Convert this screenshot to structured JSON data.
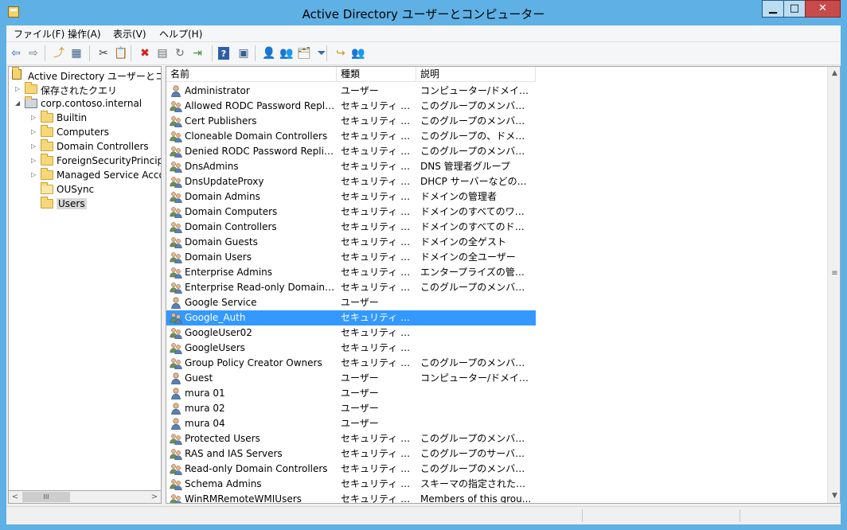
{
  "window": {
    "title": "Active Directory ユーザーとコンピューター",
    "minimize_label": "▁",
    "maximize_label": "□",
    "close_label": "✕"
  },
  "menu": [
    {
      "label": "ファイル(F)"
    },
    {
      "label": "操作(A)"
    },
    {
      "label": "表示(V)"
    },
    {
      "label": "ヘルプ(H)"
    }
  ],
  "toolbar": [
    {
      "icon": "back-arrow-icon",
      "glyph": "⇦",
      "color": "#2f6db5"
    },
    {
      "icon": "forward-arrow-icon",
      "glyph": "⇨",
      "color": "#7a7a7a"
    },
    {
      "icon": "up-folder-icon",
      "glyph": "⤴",
      "color": "#c89a2a"
    },
    {
      "icon": "show-hide-console-tree-icon",
      "glyph": "▦",
      "color": "#3a5f8a"
    },
    {
      "icon": "cut-icon",
      "glyph": "✂",
      "color": "#3a3a3a"
    },
    {
      "icon": "paste-icon",
      "glyph": "📋",
      "color": "#3a3a3a"
    },
    {
      "icon": "delete-icon",
      "glyph": "✖",
      "color": "#d42020"
    },
    {
      "icon": "properties-icon",
      "glyph": "▤",
      "color": "#6a6a6a"
    },
    {
      "icon": "refresh-icon",
      "glyph": "↻",
      "color": "#6a6a6a"
    },
    {
      "icon": "export-list-icon",
      "glyph": "⇥",
      "color": "#3f8a3f"
    },
    {
      "icon": "help-icon",
      "glyph": "?",
      "color": "#ffffff"
    },
    {
      "icon": "show-action-pane-icon",
      "glyph": "▣",
      "color": "#3a5f8a"
    },
    {
      "icon": "new-user-icon",
      "glyph": "👤",
      "color": "#5a6e8a"
    },
    {
      "icon": "new-group-icon",
      "glyph": "👥",
      "color": "#5a6e8a"
    },
    {
      "icon": "new-ou-icon",
      "glyph": "🗂",
      "color": "#7a6a3a"
    },
    {
      "icon": "filter-icon",
      "glyph": "⏷",
      "color": "#3a6a9a"
    },
    {
      "icon": "add-to-group-icon",
      "glyph": "↪",
      "color": "#c89a2a"
    },
    {
      "icon": "delegate-control-icon",
      "glyph": "👥",
      "color": "#5a6e8a"
    }
  ],
  "tree": [
    {
      "label": "Active Directory ユーザーとコンピ",
      "level": 0,
      "expander": "",
      "icon": "aduc-root-icon"
    },
    {
      "label": "保存されたクエリ",
      "level": 1,
      "expander": "▷",
      "icon": "folder-icon"
    },
    {
      "label": "corp.contoso.internal",
      "level": 1,
      "expander": "◢",
      "icon": "domain-icon"
    },
    {
      "label": "Builtin",
      "level": 2,
      "expander": "▷",
      "icon": "folder-icon"
    },
    {
      "label": "Computers",
      "level": 2,
      "expander": "▷",
      "icon": "folder-icon"
    },
    {
      "label": "Domain Controllers",
      "level": 2,
      "expander": "▷",
      "icon": "folder-icon"
    },
    {
      "label": "ForeignSecurityPrincip",
      "level": 2,
      "expander": "▷",
      "icon": "folder-icon"
    },
    {
      "label": "Managed Service Acco",
      "level": 2,
      "expander": "▷",
      "icon": "folder-icon"
    },
    {
      "label": "OUSync",
      "level": 2,
      "expander": "",
      "icon": "ou-icon"
    },
    {
      "label": "Users",
      "level": 2,
      "expander": "",
      "icon": "folder-icon",
      "selected": true
    }
  ],
  "tree_scroll": {
    "left": "<",
    "right": ">",
    "thumb": "III"
  },
  "columns": [
    {
      "label": "名前"
    },
    {
      "label": "種類"
    },
    {
      "label": "説明"
    }
  ],
  "rows": [
    {
      "name": "Administrator",
      "type": "ユーザー",
      "desc": "コンピューター/ドメインの管...",
      "icon": "user-icon"
    },
    {
      "name": "Allowed RODC Password Repli...",
      "type": "セキュリティ グル...",
      "desc": "このグループのメンバーは、...",
      "icon": "group-icon"
    },
    {
      "name": "Cert Publishers",
      "type": "セキュリティ グル...",
      "desc": "このグループのメンバーはデ...",
      "icon": "group-icon"
    },
    {
      "name": "Cloneable Domain Controllers",
      "type": "セキュリティ グル...",
      "desc": "このグループの、ドメイン コ...",
      "icon": "group-icon"
    },
    {
      "name": "Denied RODC Password Replic...",
      "type": "セキュリティ グル...",
      "desc": "このグループのメンバーは、...",
      "icon": "group-icon"
    },
    {
      "name": "DnsAdmins",
      "type": "セキュリティ グル...",
      "desc": "DNS 管理者グループ",
      "icon": "group-icon"
    },
    {
      "name": "DnsUpdateProxy",
      "type": "セキュリティ グル...",
      "desc": "DHCP サーバーなどのほか...",
      "icon": "group-icon"
    },
    {
      "name": "Domain Admins",
      "type": "セキュリティ グル...",
      "desc": "ドメインの管理者",
      "icon": "group-icon"
    },
    {
      "name": "Domain Computers",
      "type": "セキュリティ グル...",
      "desc": "ドメインのすべてのワークス...",
      "icon": "group-icon"
    },
    {
      "name": "Domain Controllers",
      "type": "セキュリティ グル...",
      "desc": "ドメインのすべてのドメイン ...",
      "icon": "group-icon"
    },
    {
      "name": "Domain Guests",
      "type": "セキュリティ グル...",
      "desc": "ドメインの全ゲスト",
      "icon": "group-icon"
    },
    {
      "name": "Domain Users",
      "type": "セキュリティ グル...",
      "desc": "ドメインの全ユーザー",
      "icon": "group-icon"
    },
    {
      "name": "Enterprise Admins",
      "type": "セキュリティ グル...",
      "desc": "エンタープライズの管理者",
      "icon": "group-icon"
    },
    {
      "name": "Enterprise Read-only Domain ...",
      "type": "セキュリティ グル...",
      "desc": "このグループのメンバーは、...",
      "icon": "group-icon"
    },
    {
      "name": "Google Service",
      "type": "ユーザー",
      "desc": "",
      "icon": "user-icon"
    },
    {
      "name": "Google_Auth",
      "type": "セキュリティ グル...",
      "desc": "",
      "icon": "group-icon",
      "selected": true
    },
    {
      "name": "GoogleUser02",
      "type": "セキュリティ グル...",
      "desc": "",
      "icon": "group-icon"
    },
    {
      "name": "GoogleUsers",
      "type": "セキュリティ グル...",
      "desc": "",
      "icon": "group-icon"
    },
    {
      "name": "Group Policy Creator Owners",
      "type": "セキュリティ グル...",
      "desc": "このグループのメンバーはド...",
      "icon": "group-icon"
    },
    {
      "name": "Guest",
      "type": "ユーザー",
      "desc": "コンピューター/ドメインへの...",
      "icon": "user-icon"
    },
    {
      "name": "mura 01",
      "type": "ユーザー",
      "desc": "",
      "icon": "user-icon"
    },
    {
      "name": "mura 02",
      "type": "ユーザー",
      "desc": "",
      "icon": "user-icon"
    },
    {
      "name": "mura 04",
      "type": "ユーザー",
      "desc": "",
      "icon": "user-icon"
    },
    {
      "name": "Protected Users",
      "type": "セキュリティ グル...",
      "desc": "このグループのメンバーには...",
      "icon": "group-icon"
    },
    {
      "name": "RAS and IAS Servers",
      "type": "セキュリティ グル...",
      "desc": "このグループのサーバーはユ...",
      "icon": "group-icon"
    },
    {
      "name": "Read-only Domain Controllers",
      "type": "セキュリティ グル...",
      "desc": "このグループのメンバーは、...",
      "icon": "group-icon"
    },
    {
      "name": "Schema Admins",
      "type": "セキュリティ グル...",
      "desc": "スキーマの指定された管理者",
      "icon": "group-icon"
    },
    {
      "name": "WinRMRemoteWMIUsers__",
      "type": "セキュリティ グル...",
      "desc": "Members of this grou...",
      "icon": "group-icon"
    }
  ],
  "list_scroll": {
    "up": "▲",
    "down": "▼",
    "grip": "≡"
  },
  "colors": {
    "selection": "#3399ff",
    "titlebar": "#5fb0e4",
    "close": "#c74b4b"
  }
}
